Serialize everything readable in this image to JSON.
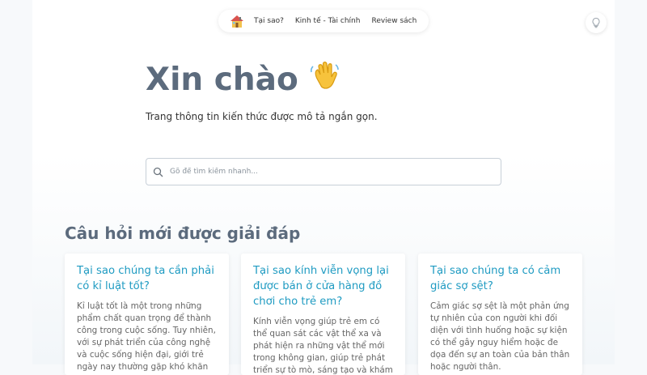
{
  "nav": {
    "logo_icon": "house-icon",
    "links": [
      "Tại sao?",
      "Kinh tế - Tài chính",
      "Review sách"
    ]
  },
  "theme_toggle": {
    "icon": "lightbulb-icon"
  },
  "hero": {
    "title": "Xin chào",
    "emoji_icon": "waving-hand-icon",
    "subtitle": "Trang thông tin kiến thức được mô tả ngắn gọn."
  },
  "search": {
    "icon": "search-icon",
    "placeholder": "Gõ để tìm kiếm nhanh...",
    "value": ""
  },
  "section": {
    "title": "Câu hỏi mới được giải đáp"
  },
  "cards": [
    {
      "title": "Tại sao chúng ta cần phải có kỉ luật tốt?",
      "excerpt": "Kỉ luật tốt là một trong những phẩm chất quan trọng để thành công trong cuộc sống. Tuy nhiên, với sự phát triển của công nghệ và cuộc sống hiện đại, giới trẻ ngày nay thường gặp khó khăn"
    },
    {
      "title": "Tại sao kính viễn vọng lại được bán ở cửa hàng đồ chơi cho trẻ em?",
      "excerpt": "Kính viễn vọng giúp trẻ em có thể quan sát các vật thể xa và phát hiện ra những vật thể mới trong không gian, giúp trẻ phát triển sự tò mò, sáng tạo và khám phá thế"
    },
    {
      "title": "Tại sao chúng ta có cảm giác sợ sệt?",
      "excerpt": "Cảm giác sợ sệt là một phản ứng tự nhiên của con người khi đối diện với tình huống hoặc sự kiện có thể gây nguy hiểm hoặc đe dọa đến sự an toàn của bản thân hoặc người thân."
    }
  ],
  "colors": {
    "heading": "#5c6b7d",
    "link": "#1f9bc2",
    "body_text": "#666666"
  }
}
